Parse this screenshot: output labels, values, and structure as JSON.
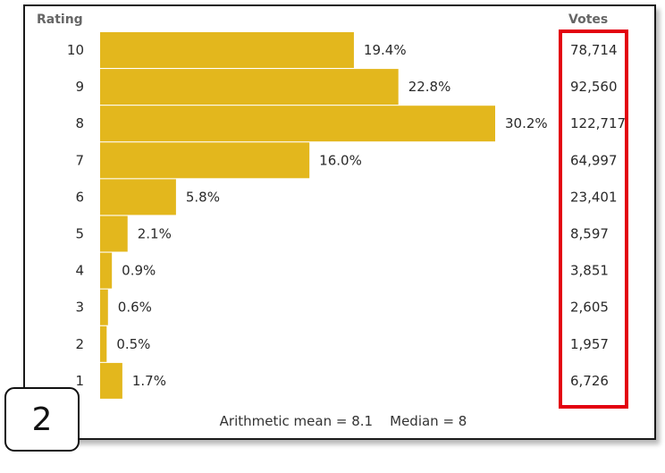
{
  "headers": {
    "rating": "Rating",
    "votes": "Votes"
  },
  "chart_data": {
    "type": "bar",
    "orientation": "horizontal",
    "categories": [
      "10",
      "9",
      "8",
      "7",
      "6",
      "5",
      "4",
      "3",
      "2",
      "1"
    ],
    "values": [
      19.4,
      22.8,
      30.2,
      16.0,
      5.8,
      2.1,
      0.9,
      0.6,
      0.5,
      1.7
    ],
    "value_labels": [
      "19.4%",
      "22.8%",
      "30.2%",
      "16.0%",
      "5.8%",
      "2.1%",
      "0.9%",
      "0.6%",
      "0.5%",
      "1.7%"
    ],
    "votes": [
      "78,714",
      "92,560",
      "122,717",
      "64,997",
      "23,401",
      "8,597",
      "3,851",
      "2,605",
      "1,957",
      "6,726"
    ],
    "bar_color": "#e3b71d"
  },
  "footer": {
    "mean": "Arithmetic mean = 8.1",
    "median": "Median = 8"
  },
  "highlight_color": "#e3000f",
  "badge": {
    "number": "2"
  }
}
